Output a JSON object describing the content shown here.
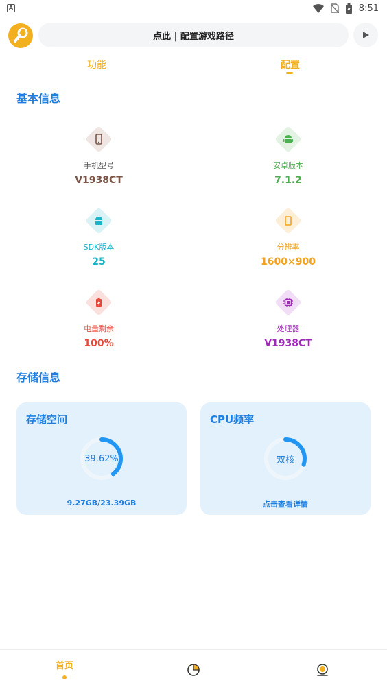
{
  "status_bar": {
    "time": "8:51"
  },
  "top_bar": {
    "path_label": "点此 | 配置游戏路径"
  },
  "tabs": [
    {
      "label": "功能",
      "active": false
    },
    {
      "label": "配置",
      "active": true
    }
  ],
  "basic_info": {
    "title": "基本信息",
    "items": [
      {
        "label": "手机型号",
        "value": "V1938CT",
        "color": "#7a5548",
        "bg": "#efe6e3",
        "icon": "phone-icon"
      },
      {
        "label": "安卓版本",
        "value": "7.1.2",
        "color": "#4caf50",
        "bg": "#e3f3e3",
        "icon": "android-icon"
      },
      {
        "label": "SDK版本",
        "value": "25",
        "color": "#1ab3c9",
        "bg": "#d9f2f6",
        "icon": "sdk-icon"
      },
      {
        "label": "分辨率",
        "value": "1600×900",
        "color": "#f3a21e",
        "bg": "#fdeed8",
        "icon": "screen-icon"
      },
      {
        "label": "电量剩余",
        "value": "100%",
        "color": "#e5473a",
        "bg": "#fbe1de",
        "icon": "battery-icon"
      },
      {
        "label": "处理器",
        "value": "V1938CT",
        "color": "#a028b8",
        "bg": "#f2ddf6",
        "icon": "chip-icon"
      }
    ]
  },
  "storage_info": {
    "title": "存储信息",
    "storage_card": {
      "title": "存储空间",
      "percent_text": "39.62%",
      "fraction": 0.3962,
      "footer": "9.27GB/23.39GB"
    },
    "cpu_card": {
      "title": "CPU频率",
      "center_text": "双核",
      "fraction": 0.3,
      "footer": "点击查看详情"
    }
  },
  "bottom_nav": {
    "home_label": "首页"
  },
  "colors": {
    "accent": "#f2b01e",
    "primary_blue": "#1e7fe0",
    "card_bg": "#e3f1fc"
  }
}
